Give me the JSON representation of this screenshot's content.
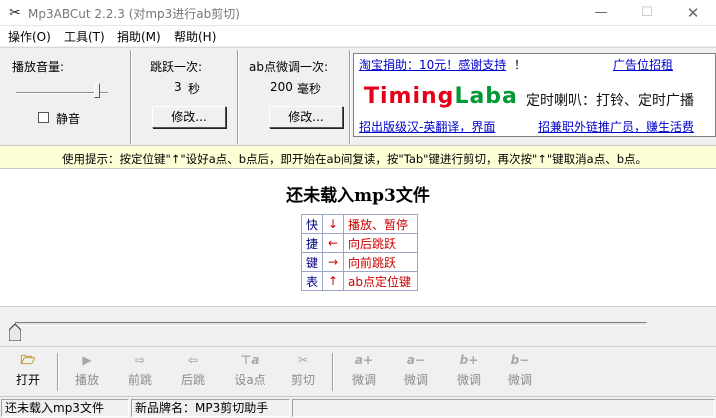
{
  "window": {
    "title": "Mp3ABCut 2.2.3  (对mp3进行ab剪切)",
    "icon": "scissors-icon",
    "min_glyph": "—",
    "max_glyph": "☐",
    "close_glyph": "✕"
  },
  "menu": [
    "操作(O)",
    "工具(T)",
    "捐助(M)",
    "帮助(H)"
  ],
  "volume": {
    "label": "播放音量:",
    "level": 0.88,
    "mute_label": "静音",
    "mute_checked": false
  },
  "jump": {
    "label": "跳跃一次:",
    "value": "3",
    "unit": "秒",
    "button": "修改..."
  },
  "ab_adjust": {
    "label": "ab点微调一次:",
    "value": "200",
    "unit": "毫秒",
    "button": "修改..."
  },
  "ad": {
    "top_link": "淘宝捐助：10元！感谢支持",
    "top_suffix": "！",
    "top_right_link": "广告位招租",
    "logo_red": "Timing",
    "logo_green": "Laba",
    "tagline": "定时喇叭：打铃、定时广播",
    "bottom_left_link": "招出版级汉-英翻译，界面",
    "bottom_right_link": "招兼职外链推广员，赚生活费"
  },
  "tip": "使用提示：按定位键\"↑\"设好a点、b点后，即开始在ab间复读，按\"Tab\"键进行剪切，再次按\"↑\"键取消a点、b点。",
  "main": {
    "status_title": "还未载入mp3文件",
    "hotkey_title": [
      "快",
      "捷",
      "键",
      "表"
    ],
    "hotkeys": [
      {
        "key": "↓",
        "action": "播放、暂停"
      },
      {
        "key": "←",
        "action": "向后跳跃"
      },
      {
        "key": "→",
        "action": "向前跳跃"
      },
      {
        "key": "↑",
        "action": "ab点定位键"
      }
    ]
  },
  "seek": {
    "position": 0.0
  },
  "toolbar": [
    {
      "name": "open",
      "icon": "folder-open-icon",
      "glyph": "🗁",
      "label": "打开",
      "enabled": true
    },
    {
      "name": "play",
      "icon": "play-icon",
      "glyph": "▶",
      "label": "播放",
      "enabled": false
    },
    {
      "name": "forward",
      "icon": "forward-icon",
      "glyph": "⇨",
      "label": "前跳",
      "enabled": false
    },
    {
      "name": "back",
      "icon": "back-icon",
      "glyph": "⇦",
      "label": "后跳",
      "enabled": false
    },
    {
      "name": "set-a",
      "icon": "pin-a-icon",
      "glyph": "⊤a",
      "label": "设a点",
      "enabled": false
    },
    {
      "name": "cut",
      "icon": "scissors-icon",
      "glyph": "✂",
      "label": "剪切",
      "enabled": false
    },
    {
      "name": "a-plus",
      "icon": "a-plus-icon",
      "glyph": "a+",
      "label": "微调",
      "enabled": false
    },
    {
      "name": "a-minus",
      "icon": "a-minus-icon",
      "glyph": "a−",
      "label": "微调",
      "enabled": false
    },
    {
      "name": "b-plus",
      "icon": "b-plus-icon",
      "glyph": "b+",
      "label": "微调",
      "enabled": false
    },
    {
      "name": "b-minus",
      "icon": "b-minus-icon",
      "glyph": "b−",
      "label": "微调",
      "enabled": false
    }
  ],
  "status": {
    "left": "还未载入mp3文件",
    "right": "新品牌名：MP3剪切助手"
  }
}
